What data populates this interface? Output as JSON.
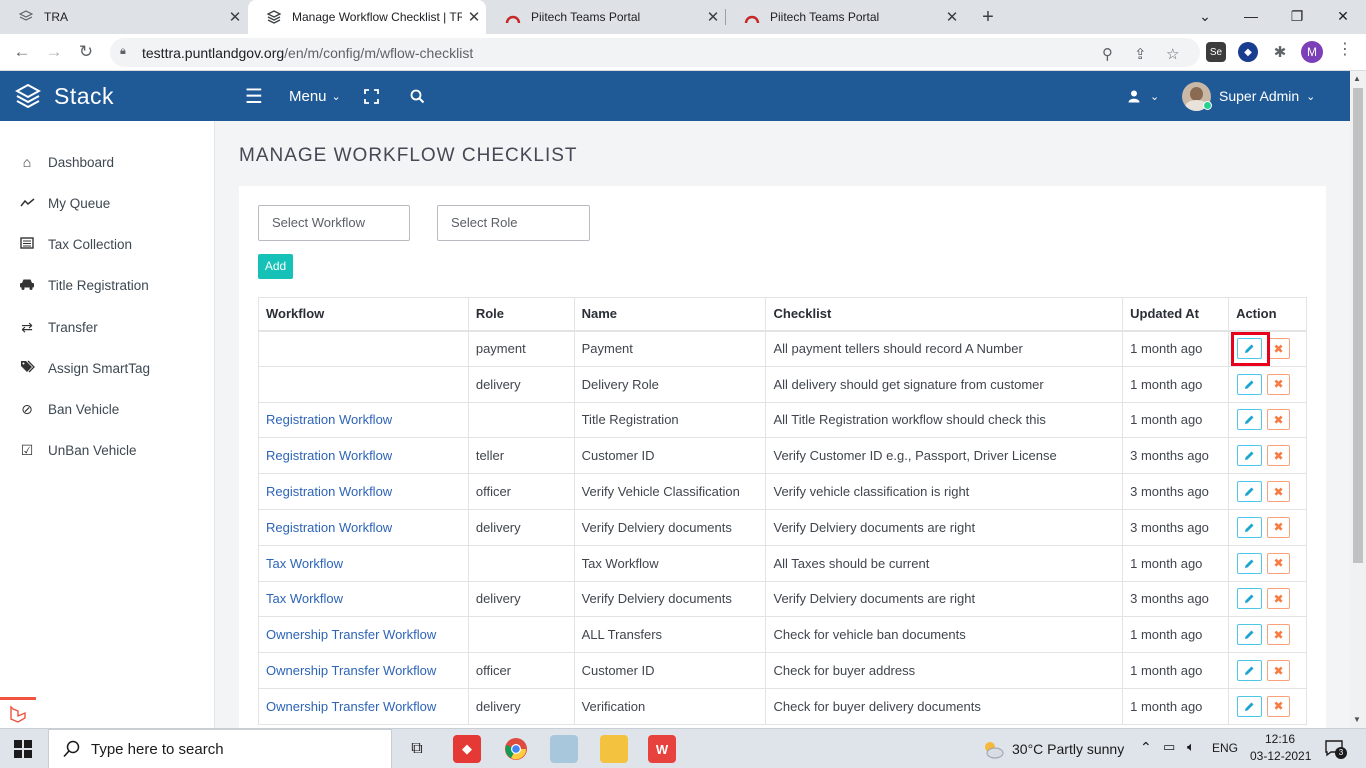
{
  "browser": {
    "tabs": [
      {
        "title": "TRA",
        "active": false
      },
      {
        "title": "Manage Workflow Checklist | TRA",
        "active": true
      },
      {
        "title": "Piitech Teams Portal",
        "active": false
      },
      {
        "title": "Piitech Teams Portal",
        "active": false
      }
    ],
    "url_host": "testtra.puntlandgov.org",
    "url_path": "/en/m/config/m/wflow-checklist",
    "profile_initial": "M"
  },
  "app": {
    "brand": "Stack",
    "menu_label": "Menu",
    "user_name": "Super Admin"
  },
  "sidebar": {
    "items": [
      {
        "label": "Dashboard",
        "icon": "home-icon"
      },
      {
        "label": "My Queue",
        "icon": "trend-icon"
      },
      {
        "label": "Tax Collection",
        "icon": "list-icon"
      },
      {
        "label": "Title Registration",
        "icon": "car-icon"
      },
      {
        "label": "Transfer",
        "icon": "exchange-icon"
      },
      {
        "label": "Assign SmartTag",
        "icon": "tags-icon"
      },
      {
        "label": "Ban Vehicle",
        "icon": "ban-icon"
      },
      {
        "label": "UnBan Vehicle",
        "icon": "check-square-icon"
      }
    ]
  },
  "page": {
    "title": "MANAGE WORKFLOW CHECKLIST",
    "select_workflow_placeholder": "Select Workflow",
    "select_role_placeholder": "Select Role",
    "add_label": "Add"
  },
  "table": {
    "headers": [
      "Workflow",
      "Role",
      "Name",
      "Checklist",
      "Updated At",
      "Action"
    ],
    "rows": [
      {
        "workflow": "",
        "role": "payment",
        "name": "Payment",
        "checklist": "All payment tellers should record A Number",
        "updated": "1 month ago"
      },
      {
        "workflow": "",
        "role": "delivery",
        "name": "Delivery Role",
        "checklist": "All delivery should get signature from customer",
        "updated": "1 month ago"
      },
      {
        "workflow": "Registration Workflow",
        "role": "",
        "name": "Title Registration",
        "checklist": "All Title Registration workflow should check this",
        "updated": "1 month ago"
      },
      {
        "workflow": "Registration Workflow",
        "role": "teller",
        "name": "Customer ID",
        "checklist": "Verify Customer ID e.g., Passport, Driver License",
        "updated": "3 months ago"
      },
      {
        "workflow": "Registration Workflow",
        "role": "officer",
        "name": "Verify Vehicle Classification",
        "checklist": "Verify vehicle classification is right",
        "updated": "3 months ago"
      },
      {
        "workflow": "Registration Workflow",
        "role": "delivery",
        "name": "Verify Delviery documents",
        "checklist": "Verify Delviery documents are right",
        "updated": "3 months ago"
      },
      {
        "workflow": "Tax Workflow",
        "role": "",
        "name": "Tax Workflow",
        "checklist": "All Taxes should be current",
        "updated": "1 month ago"
      },
      {
        "workflow": "Tax Workflow",
        "role": "delivery",
        "name": "Verify Delviery documents",
        "checklist": "Verify Delviery documents are right",
        "updated": "3 months ago"
      },
      {
        "workflow": "Ownership Transfer Workflow",
        "role": "",
        "name": "ALL Transfers",
        "checklist": "Check for vehicle ban documents",
        "updated": "1 month ago"
      },
      {
        "workflow": "Ownership Transfer Workflow",
        "role": "officer",
        "name": "Customer ID",
        "checklist": "Check for buyer address",
        "updated": "1 month ago"
      },
      {
        "workflow": "Ownership Transfer Workflow",
        "role": "delivery",
        "name": "Verification",
        "checklist": "Check for buyer delivery documents",
        "updated": "1 month ago"
      }
    ]
  },
  "taskbar": {
    "search_placeholder": "Type here to search",
    "weather": "30°C  Partly sunny",
    "lang": "ENG",
    "time": "12:16",
    "date": "03-12-2021",
    "notifications": "3"
  },
  "colors": {
    "header_blue": "#1f5a96",
    "link_blue": "#2d64b8",
    "add_teal": "#16c1b7",
    "highlight_red": "#e8001c"
  }
}
